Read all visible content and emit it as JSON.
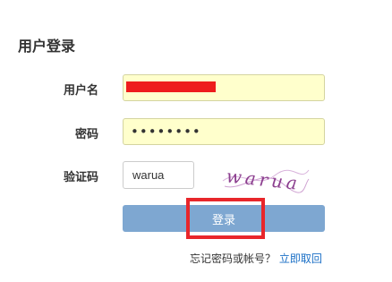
{
  "page": {
    "title": "用户登录"
  },
  "form": {
    "username_label": "用户名",
    "password_label": "密码",
    "password_masked": "••••••••",
    "captcha_label": "验证码",
    "captcha_value": "warua",
    "captcha_image_text": "warua",
    "login_label": "登录",
    "forgot_text": "忘记密码或帐号？",
    "recover_link": "立即取回"
  },
  "colors": {
    "input_bg": "#ffffcc",
    "button_bg": "#7ea7d1",
    "redaction": "#ee1c1c",
    "highlight": "#e8262b",
    "link": "#1a6fc6",
    "captcha_text": "#8c3f8f"
  }
}
